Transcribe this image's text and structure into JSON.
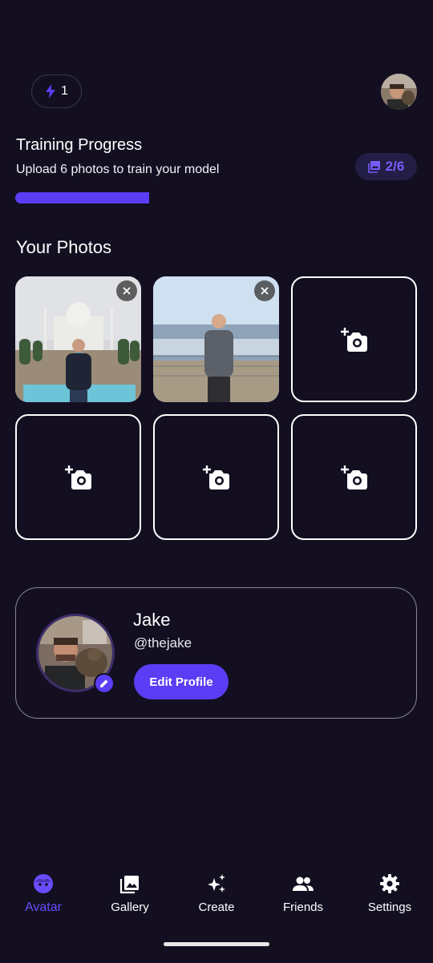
{
  "header": {
    "credits": "1",
    "credit_icon": "bolt-icon",
    "accent": "#5b3df5"
  },
  "training": {
    "title": "Training Progress",
    "subtitle": "Upload 6 photos to train your model",
    "progress_fraction": 0.333,
    "count_label": "2/6",
    "count_icon": "photo-library-icon"
  },
  "photos": {
    "title": "Your Photos",
    "slots": [
      {
        "state": "filled",
        "description": "photo-1"
      },
      {
        "state": "filled",
        "description": "photo-2"
      },
      {
        "state": "empty"
      },
      {
        "state": "empty"
      },
      {
        "state": "empty"
      },
      {
        "state": "empty"
      }
    ]
  },
  "profile": {
    "name": "Jake",
    "handle": "@thejake",
    "edit_label": "Edit Profile"
  },
  "nav": {
    "items": [
      {
        "label": "Avatar",
        "icon": "avatar-face-icon",
        "active": true
      },
      {
        "label": "Gallery",
        "icon": "gallery-icon",
        "active": false
      },
      {
        "label": "Create",
        "icon": "sparkles-icon",
        "active": false
      },
      {
        "label": "Friends",
        "icon": "people-icon",
        "active": false
      },
      {
        "label": "Settings",
        "icon": "gear-icon",
        "active": false
      }
    ]
  }
}
